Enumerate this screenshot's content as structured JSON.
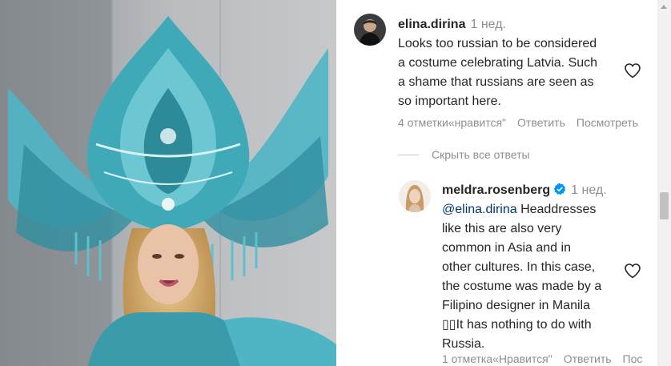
{
  "comment1": {
    "username": "elina.dirina",
    "time": "1 нед.",
    "lines": [
      "Looks too russian to be considered",
      "a costume celebrating Latvia. Such",
      "a shame that russians are seen as",
      "so important here."
    ],
    "likes": "4 отметки«нравится\"",
    "reply": "Ответить",
    "translate": "Посмотреть"
  },
  "hide_replies": "Скрыть все ответы",
  "reply1": {
    "username": "meldra.rosenberg",
    "time": "1 нед.",
    "mention": "@elina.dirina",
    "first_line_rest": " Headdresses",
    "lines": [
      "like this are also very",
      "common in Asia and in",
      "other cultures. In this case,",
      "the costume was made by a",
      "Filipino designer in Manila",
      "▯▯It has nothing to do with",
      "Russia."
    ],
    "likes": "1 отметка«Нравится\"",
    "reply": "Ответить",
    "translate": "Пос"
  },
  "icons": {
    "like": "heart-outline-icon",
    "verified": "verified-badge-icon"
  },
  "colors": {
    "text": "#262626",
    "secondary": "#8e8e8e",
    "mention": "#00376b",
    "verified": "#0095f6",
    "costume": "#3fa9b8"
  }
}
